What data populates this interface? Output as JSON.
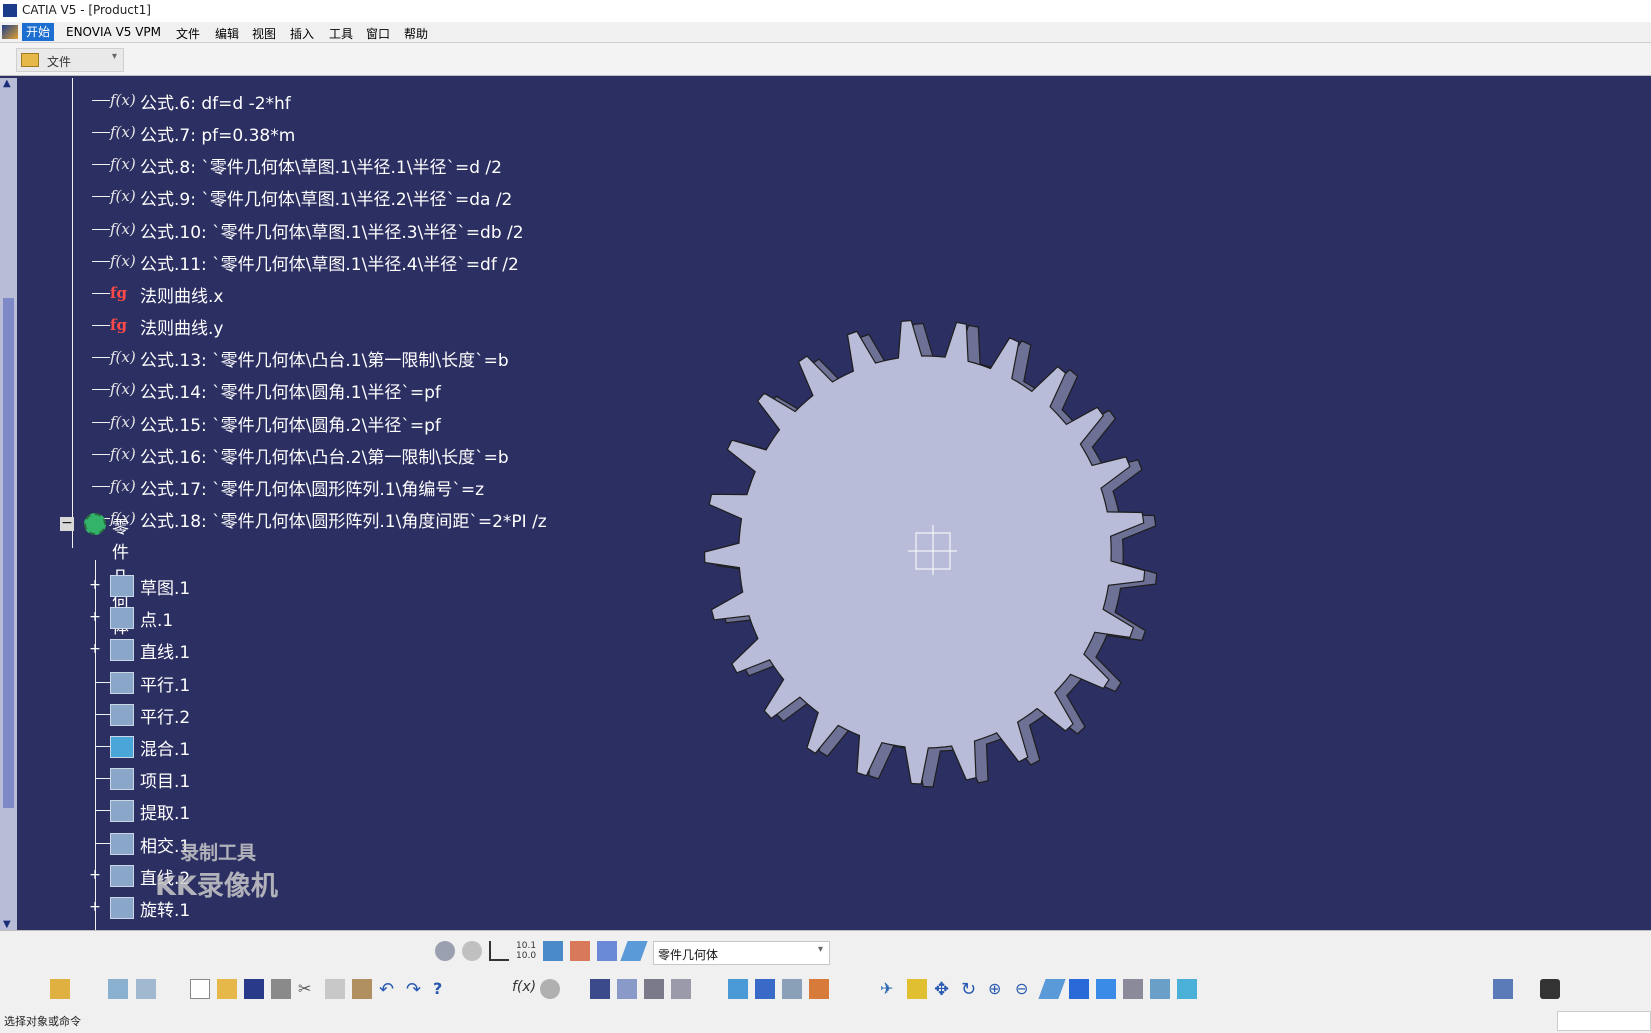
{
  "window": {
    "title": "CATIA V5 - [Product1]"
  },
  "menu": {
    "items": [
      "开始",
      "ENOVIA V5 VPM",
      "文件",
      "编辑",
      "视图",
      "插入",
      "工具",
      "窗口",
      "帮助"
    ]
  },
  "filebar": {
    "combo_value": "文件"
  },
  "tree": {
    "formulas": [
      {
        "icon": "formula-icon",
        "label": "公式.6: df=d -2*hf"
      },
      {
        "icon": "formula-icon",
        "label": "公式.7: pf=0.38*m"
      },
      {
        "icon": "formula-icon",
        "label": "公式.8: `零件几何体\\草图.1\\半径.1\\半径`=d /2"
      },
      {
        "icon": "formula-icon",
        "label": "公式.9: `零件几何体\\草图.1\\半径.2\\半径`=da /2"
      },
      {
        "icon": "formula-icon",
        "label": "公式.10: `零件几何体\\草图.1\\半径.3\\半径`=db /2"
      },
      {
        "icon": "formula-icon",
        "label": "公式.11: `零件几何体\\草图.1\\半径.4\\半径`=df /2"
      },
      {
        "icon": "law-icon",
        "label": "法则曲线.x"
      },
      {
        "icon": "law-icon",
        "label": "法则曲线.y"
      },
      {
        "icon": "formula-icon",
        "label": "公式.13: `零件几何体\\凸台.1\\第一限制\\长度`=b"
      },
      {
        "icon": "formula-icon",
        "label": "公式.14: `零件几何体\\圆角.1\\半径`=pf"
      },
      {
        "icon": "formula-icon",
        "label": "公式.15: `零件几何体\\圆角.2\\半径`=pf"
      },
      {
        "icon": "formula-icon",
        "label": "公式.16: `零件几何体\\凸台.2\\第一限制\\长度`=b"
      },
      {
        "icon": "formula-icon",
        "label": "公式.17: `零件几何体\\圆形阵列.1\\角编号`=z"
      },
      {
        "icon": "formula-icon",
        "label": "公式.18: `零件几何体\\圆形阵列.1\\角度间距`=2*PI /z"
      }
    ],
    "body": {
      "label": "零件几何体"
    },
    "features": [
      {
        "icon": "sketch-icon",
        "label": "草图.1",
        "expandable": true
      },
      {
        "icon": "point-icon",
        "label": "点.1",
        "expandable": true
      },
      {
        "icon": "line-icon",
        "label": "直线.1",
        "expandable": true
      },
      {
        "icon": "parallel-curve-icon",
        "label": "平行.1",
        "expandable": false
      },
      {
        "icon": "parallel-curve-icon",
        "label": "平行.2",
        "expandable": false
      },
      {
        "icon": "blend-icon",
        "label": "混合.1",
        "expandable": false
      },
      {
        "icon": "project-icon",
        "label": "项目.1",
        "expandable": false
      },
      {
        "icon": "extract-icon",
        "label": "提取.1",
        "expandable": false
      },
      {
        "icon": "intersect-icon",
        "label": "相交.1",
        "expandable": false
      },
      {
        "icon": "line-icon",
        "label": "直线.2",
        "expandable": true
      },
      {
        "icon": "rotate-icon",
        "label": "旋转.1",
        "expandable": true
      }
    ]
  },
  "watermark": {
    "line1": "录制工具",
    "line2": "KK录像机"
  },
  "model": {
    "gear_teeth": 25
  },
  "toolbar": {
    "body_combo_value": "零件几何体"
  },
  "status": {
    "text": "选择对象或命令"
  },
  "colors": {
    "background": "#2c2f62",
    "gear_face": "#b9bcd8",
    "gear_side": "#6e7196",
    "menu_active": "#1c6fd1"
  }
}
